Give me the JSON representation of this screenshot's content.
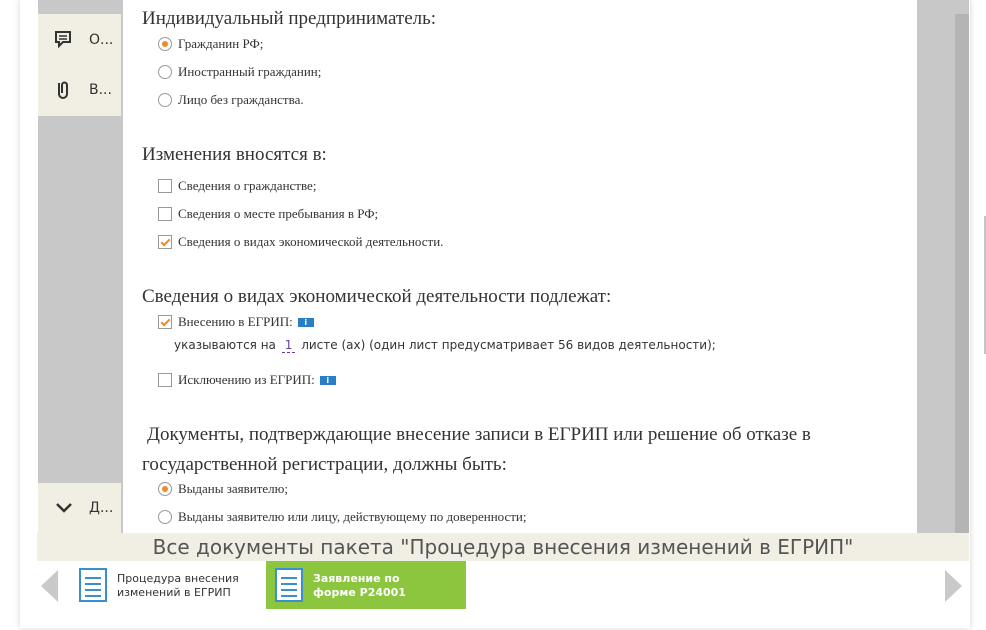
{
  "sidebar": {
    "items": [
      {
        "icon": "comment-icon",
        "label": "О..."
      },
      {
        "icon": "attachment-icon",
        "label": "В..."
      }
    ],
    "bottom_item": {
      "icon": "chevron-down-icon",
      "label": "Д..."
    }
  },
  "form": {
    "sections": [
      {
        "title": "Индивидуальный предприниматель:",
        "type": "radio",
        "options": [
          {
            "label": "Гражданин РФ;",
            "selected": true
          },
          {
            "label": "Иностранный гражданин;",
            "selected": false
          },
          {
            "label": "Лицо без гражданства.",
            "selected": false
          }
        ]
      },
      {
        "title": "Изменения вносятся в:",
        "type": "checkbox",
        "options": [
          {
            "label": "Сведения о гражданстве;",
            "checked": false
          },
          {
            "label": "Сведения о месте пребывания в РФ;",
            "checked": false
          },
          {
            "label": "Сведения о видах экономической деятельности.",
            "checked": true
          }
        ]
      },
      {
        "title": "Сведения о видах экономической деятельности подлежат:",
        "type": "checkbox",
        "options": [
          {
            "label": "Внесению в ЕГРИП:",
            "checked": true,
            "info": "i"
          },
          {
            "label": "Исключению из ЕГРИП:",
            "checked": false,
            "info": "i"
          }
        ],
        "sheets_line": {
          "prefix": "указываются на",
          "value": "1",
          "suffix": "листе (ах) (один лист предусматривает 56 видов деятельности);"
        }
      },
      {
        "title_line1": "Документы, подтверждающие внесение записи в ЕГРИП или решение об отказе в",
        "title_line2": "государственной регистрации, должны быть:",
        "type": "radio",
        "options": [
          {
            "label": "Выданы заявителю;",
            "selected": true
          },
          {
            "label": "Выданы заявителю или лицу, действующему по доверенности;",
            "selected": false
          }
        ]
      }
    ]
  },
  "package_bar": {
    "title": "Все документы пакета \"Процедура внесения изменений в ЕГРИП\"",
    "documents": [
      {
        "label": "Процедура внесения изменений в ЕГРИП",
        "active": false
      },
      {
        "label": "Заявление по форме Р24001",
        "active": true
      }
    ]
  },
  "colors": {
    "accent_orange": "#f08a24",
    "active_green": "#8cc63f",
    "doc_icon_blue": "#3b8fd1",
    "panel_beige": "#f1efe3"
  }
}
